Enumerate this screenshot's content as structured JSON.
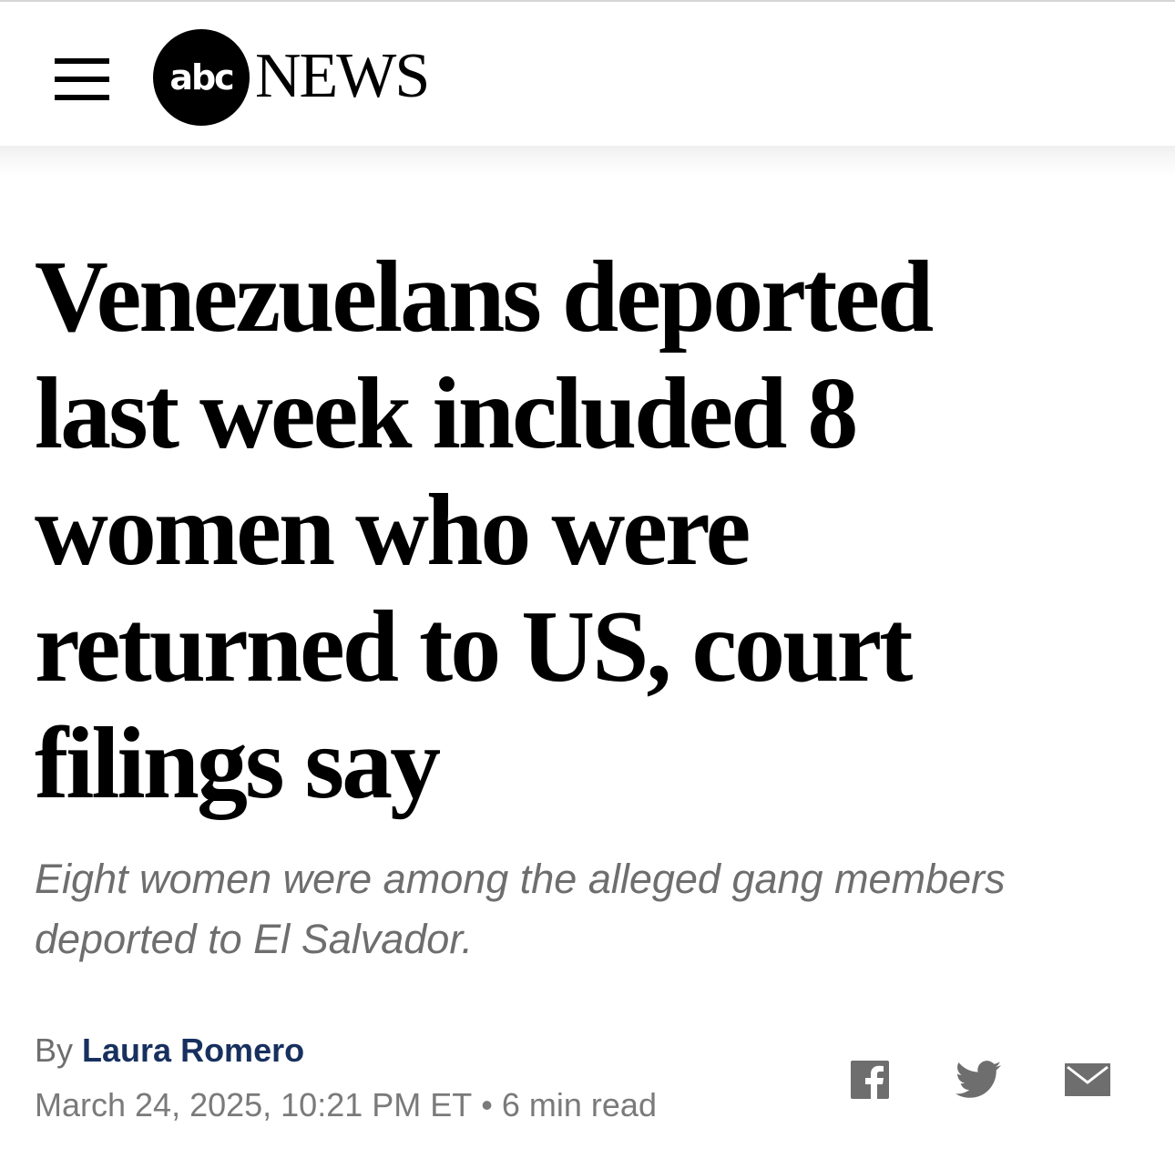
{
  "header": {
    "menu_icon": "hamburger-menu-icon",
    "logo_abc": "abc",
    "logo_news": "NEWS"
  },
  "article": {
    "headline": "Venezuelans deported last week included 8 women who were returned to US, court filings say",
    "subheadline": "Eight women were among the alleged gang members deported to El Salvador.",
    "byline_prefix": "By",
    "author": "Laura Romero",
    "date": "March 24, 2025, 10:21 PM ET",
    "separator": "•",
    "read_time": "6 min read"
  },
  "share": {
    "icons": [
      "facebook-icon",
      "twitter-icon",
      "email-icon"
    ]
  },
  "colors": {
    "author_link": "#17305e",
    "meta_text": "#6e6e6e",
    "header_bg": "#ffffff"
  }
}
